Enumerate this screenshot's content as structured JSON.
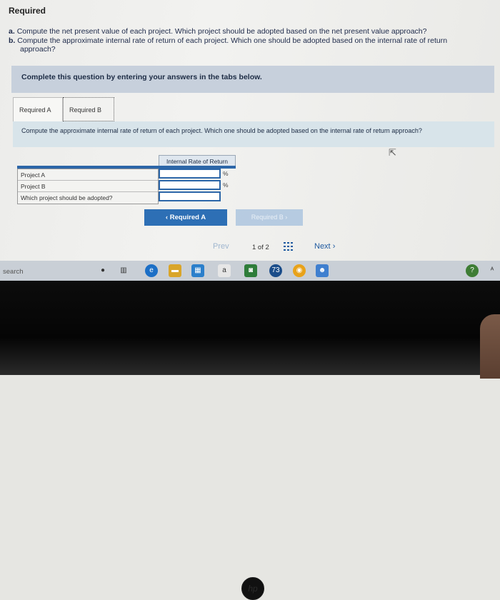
{
  "required_heading": "Required",
  "questions": [
    {
      "prefix": "a.",
      "text": "Compute the net present value of each project. Which project should be adopted based on the net present value approach?"
    },
    {
      "prefix": "b.",
      "text": "Compute the approximate internal rate of return of each project. Which one should be adopted based on the internal rate of return"
    },
    {
      "prefix": "",
      "text": "approach?"
    }
  ],
  "banner": "Complete this question by entering your answers in the tabs below.",
  "tabs": [
    "Required A",
    "Required B"
  ],
  "instruction": "Compute the approximate internal rate of return of each project. Which one should be adopted based on the internal rate of return approach?",
  "table": {
    "header": "Internal Rate of Return",
    "rows": [
      "Project A",
      "Project B",
      "Which project should be adopted?"
    ],
    "unit": "%",
    "values": [
      "",
      ""
    ]
  },
  "buttons": {
    "back": "Required A",
    "forward": "Required B"
  },
  "pager": {
    "prev": "Prev",
    "info": "1 of 2",
    "next": "Next"
  },
  "taskbar": {
    "search": "search",
    "badge": "73"
  },
  "colors": {
    "accent": "#2d6fb5",
    "banner_bg": "#c7d0dc",
    "instruction_bg": "#d8e4ea"
  }
}
